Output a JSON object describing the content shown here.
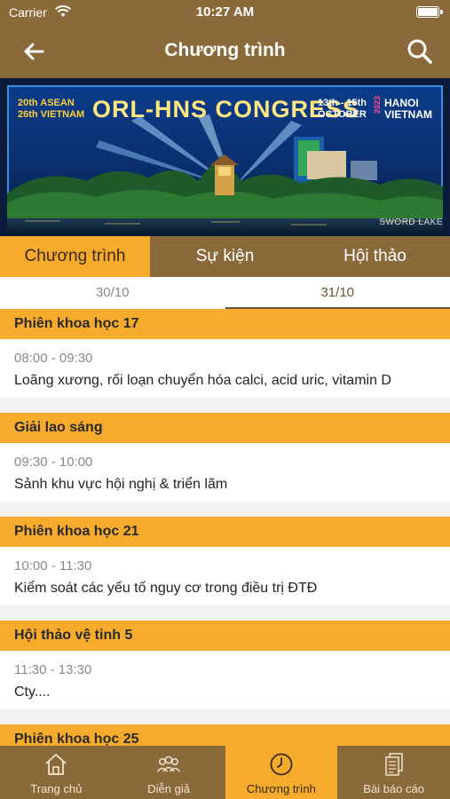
{
  "status_bar": {
    "carrier": "Carrier",
    "time": "10:27 AM"
  },
  "nav": {
    "title": "Chương trình"
  },
  "banner": {
    "line1": "20th ASEAN",
    "line2": "26th VIETNAM",
    "congress": "ORL-HNS CONGRESS",
    "dates1": "13th - 15th",
    "dates2": "OCTOBER",
    "year": "2023",
    "city1": "HANOI",
    "city2": "VIETNAM",
    "lake": "SWORD LAKE"
  },
  "tabs": [
    "Chương trình",
    "Sự kiện",
    "Hội thảo"
  ],
  "dates": [
    "30/10",
    "31/10"
  ],
  "sessions": [
    {
      "title": "Phiên khoa học 17",
      "time": "08:00 - 09:30",
      "desc": "Loãng xương, rối loạn chuyển hóa calci, acid uric, vitamin D"
    },
    {
      "title": "Giải lao sáng",
      "time": "09:30 - 10:00",
      "desc": "Sảnh khu vực hội nghị & triển lãm"
    },
    {
      "title": "Phiên khoa học 21",
      "time": "10:00 - 11:30",
      "desc": "Kiểm soát các yếu tố nguy cơ trong điều trị ĐTĐ"
    },
    {
      "title": "Hội thảo vệ tinh 5",
      "time": "11:30 - 13:30",
      "desc": "Cty...."
    },
    {
      "title": "Phiên khoa học 25",
      "time": "",
      "desc": ""
    }
  ],
  "tabbar": [
    {
      "label": "Trang chủ",
      "icon": "home-icon"
    },
    {
      "label": "Diễn giả",
      "icon": "speakers-icon"
    },
    {
      "label": "Chương trình",
      "icon": "clock-icon"
    },
    {
      "label": "Bài báo cáo",
      "icon": "documents-icon"
    }
  ],
  "colors": {
    "brown": "#8a6a3b",
    "accent": "#f6ab2c"
  }
}
